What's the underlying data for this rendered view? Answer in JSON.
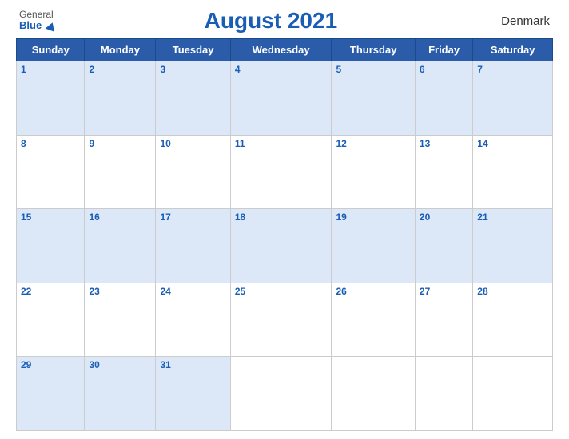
{
  "header": {
    "logo_general": "General",
    "logo_blue": "Blue",
    "title": "August 2021",
    "country": "Denmark"
  },
  "days_of_week": [
    "Sunday",
    "Monday",
    "Tuesday",
    "Wednesday",
    "Thursday",
    "Friday",
    "Saturday"
  ],
  "weeks": [
    [
      1,
      2,
      3,
      4,
      5,
      6,
      7
    ],
    [
      8,
      9,
      10,
      11,
      12,
      13,
      14
    ],
    [
      15,
      16,
      17,
      18,
      19,
      20,
      21
    ],
    [
      22,
      23,
      24,
      25,
      26,
      27,
      28
    ],
    [
      29,
      30,
      31,
      null,
      null,
      null,
      null
    ]
  ]
}
